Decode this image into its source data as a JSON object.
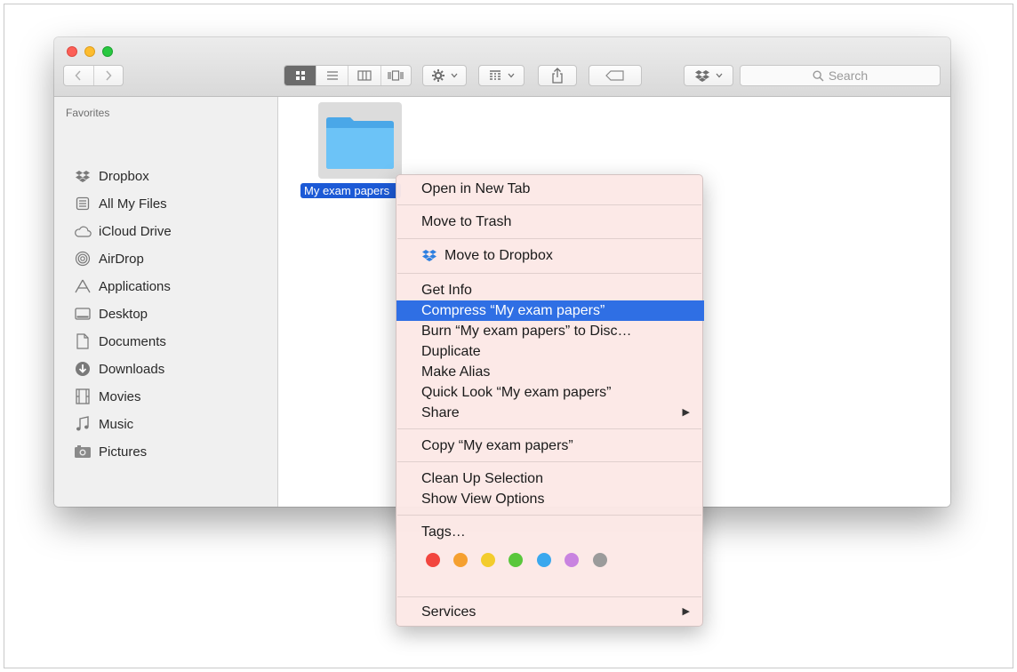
{
  "toolbar": {
    "view_modes": [
      "icon-view",
      "list-view",
      "column-view",
      "cover-flow-view"
    ],
    "search_placeholder": "Search"
  },
  "sidebar": {
    "header": "Favorites",
    "items": [
      {
        "label": "Dropbox",
        "icon": "dropbox-icon"
      },
      {
        "label": "All My Files",
        "icon": "all-files-icon"
      },
      {
        "label": "iCloud Drive",
        "icon": "cloud-icon"
      },
      {
        "label": "AirDrop",
        "icon": "airdrop-icon"
      },
      {
        "label": "Applications",
        "icon": "applications-icon"
      },
      {
        "label": "Desktop",
        "icon": "desktop-icon"
      },
      {
        "label": "Documents",
        "icon": "documents-icon"
      },
      {
        "label": "Downloads",
        "icon": "downloads-icon"
      },
      {
        "label": "Movies",
        "icon": "movies-icon"
      },
      {
        "label": "Music",
        "icon": "music-icon"
      },
      {
        "label": "Pictures",
        "icon": "pictures-icon"
      }
    ]
  },
  "content": {
    "folder_label": "My exam papers"
  },
  "context_menu": {
    "open_new_tab": "Open in New Tab",
    "move_to_trash": "Move to Trash",
    "move_to_dropbox": "Move to Dropbox",
    "get_info": "Get Info",
    "compress": "Compress “My exam papers”",
    "burn": "Burn “My exam papers” to Disc…",
    "duplicate": "Duplicate",
    "make_alias": "Make Alias",
    "quick_look": "Quick Look “My exam papers”",
    "share": "Share",
    "copy": "Copy “My exam papers”",
    "clean_up": "Clean Up Selection",
    "show_view_options": "Show View Options",
    "tags": "Tags…",
    "services": "Services",
    "highlighted_item": "compress",
    "tag_colors": [
      "#f2463f",
      "#f5a030",
      "#f3cc2c",
      "#5ac73b",
      "#3aa8ee",
      "#c983e0",
      "#9b9b9b"
    ]
  }
}
